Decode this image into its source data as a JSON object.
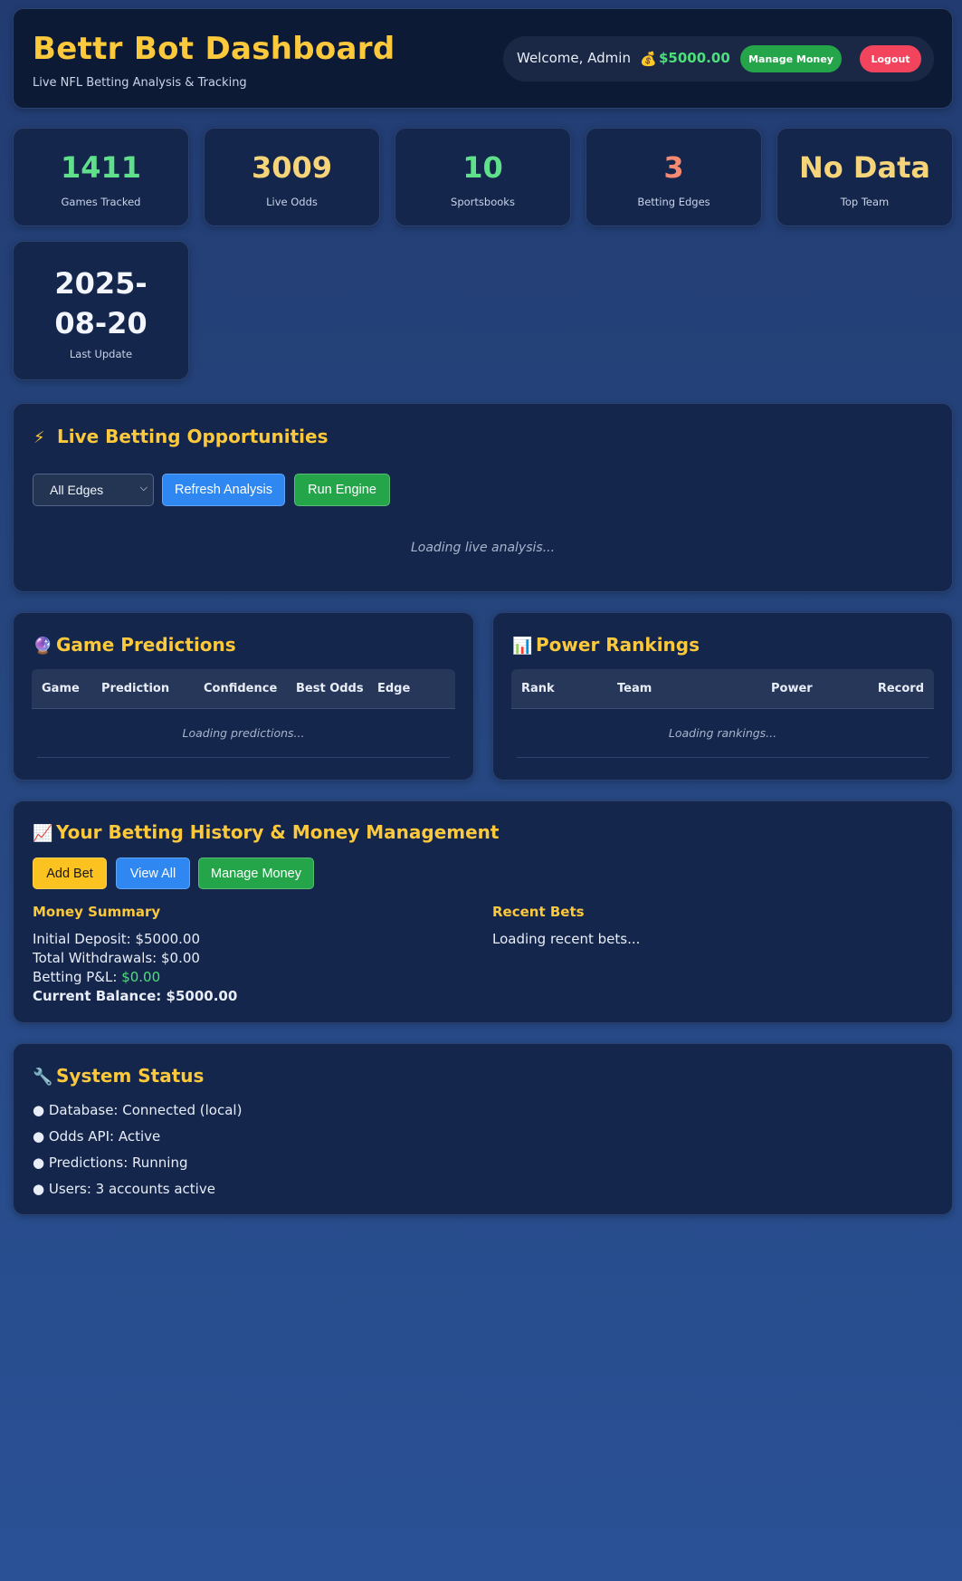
{
  "header": {
    "title": "Bettr Bot Dashboard",
    "subtitle": "Live NFL Betting Analysis & Tracking",
    "welcome": "Welcome, Admin",
    "balance": "$5000.00",
    "manage_money_label": "Manage Money",
    "logout_label": "Logout"
  },
  "stats": {
    "games": {
      "value": "1411",
      "label": "Games Tracked"
    },
    "odds": {
      "value": "3009",
      "label": "Live Odds"
    },
    "books": {
      "value": "10",
      "label": "Sportsbooks"
    },
    "edges": {
      "value": "3",
      "label": "Betting Edges"
    },
    "team": {
      "value": "No Data",
      "label": "Top Team"
    },
    "update": {
      "value": "2025-08-20",
      "label": "Last Update"
    }
  },
  "live": {
    "title": "Live Betting Opportunities",
    "filter_selected": "All Edges",
    "refresh_label": "Refresh Analysis",
    "run_label": "Run Engine",
    "loading": "Loading live analysis..."
  },
  "predictions": {
    "title": "Game Predictions",
    "columns": [
      "Game",
      "Prediction",
      "Confidence",
      "Best Odds",
      "Edge"
    ],
    "loading": "Loading predictions..."
  },
  "rankings": {
    "title": "Power Rankings",
    "columns": [
      "Rank",
      "Team",
      "Power",
      "Record"
    ],
    "loading": "Loading rankings..."
  },
  "history": {
    "title": "Your Betting History & Money Management",
    "add_label": "Add Bet",
    "view_all_label": "View All",
    "manage_label": "Manage Money",
    "money_summary_title": "Money Summary",
    "initial_deposit": "Initial Deposit: $5000.00",
    "total_withdrawals": "Total Withdrawals: $0.00",
    "pnl_label": "Betting P&L:",
    "pnl_value": "$0.00",
    "current_balance": "Current Balance: $5000.00",
    "recent_title": "Recent Bets",
    "recent_loading": "Loading recent bets..."
  },
  "system": {
    "title": "System Status",
    "items": [
      "● Database: Connected (local)",
      "● Odds API: Active",
      "● Predictions: Running",
      "● Users: 3 accounts active"
    ]
  },
  "colors": {
    "accent": "#fcc83c",
    "positive": "#4ce07a",
    "danger": "#f2445c",
    "primary": "#2f87f2"
  },
  "icons": {
    "live": "lightning-icon",
    "predictions": "crystal-ball-icon",
    "rankings": "bar-chart-icon",
    "history": "trend-up-icon",
    "system": "wrench-icon",
    "money": "money-bag-icon"
  }
}
